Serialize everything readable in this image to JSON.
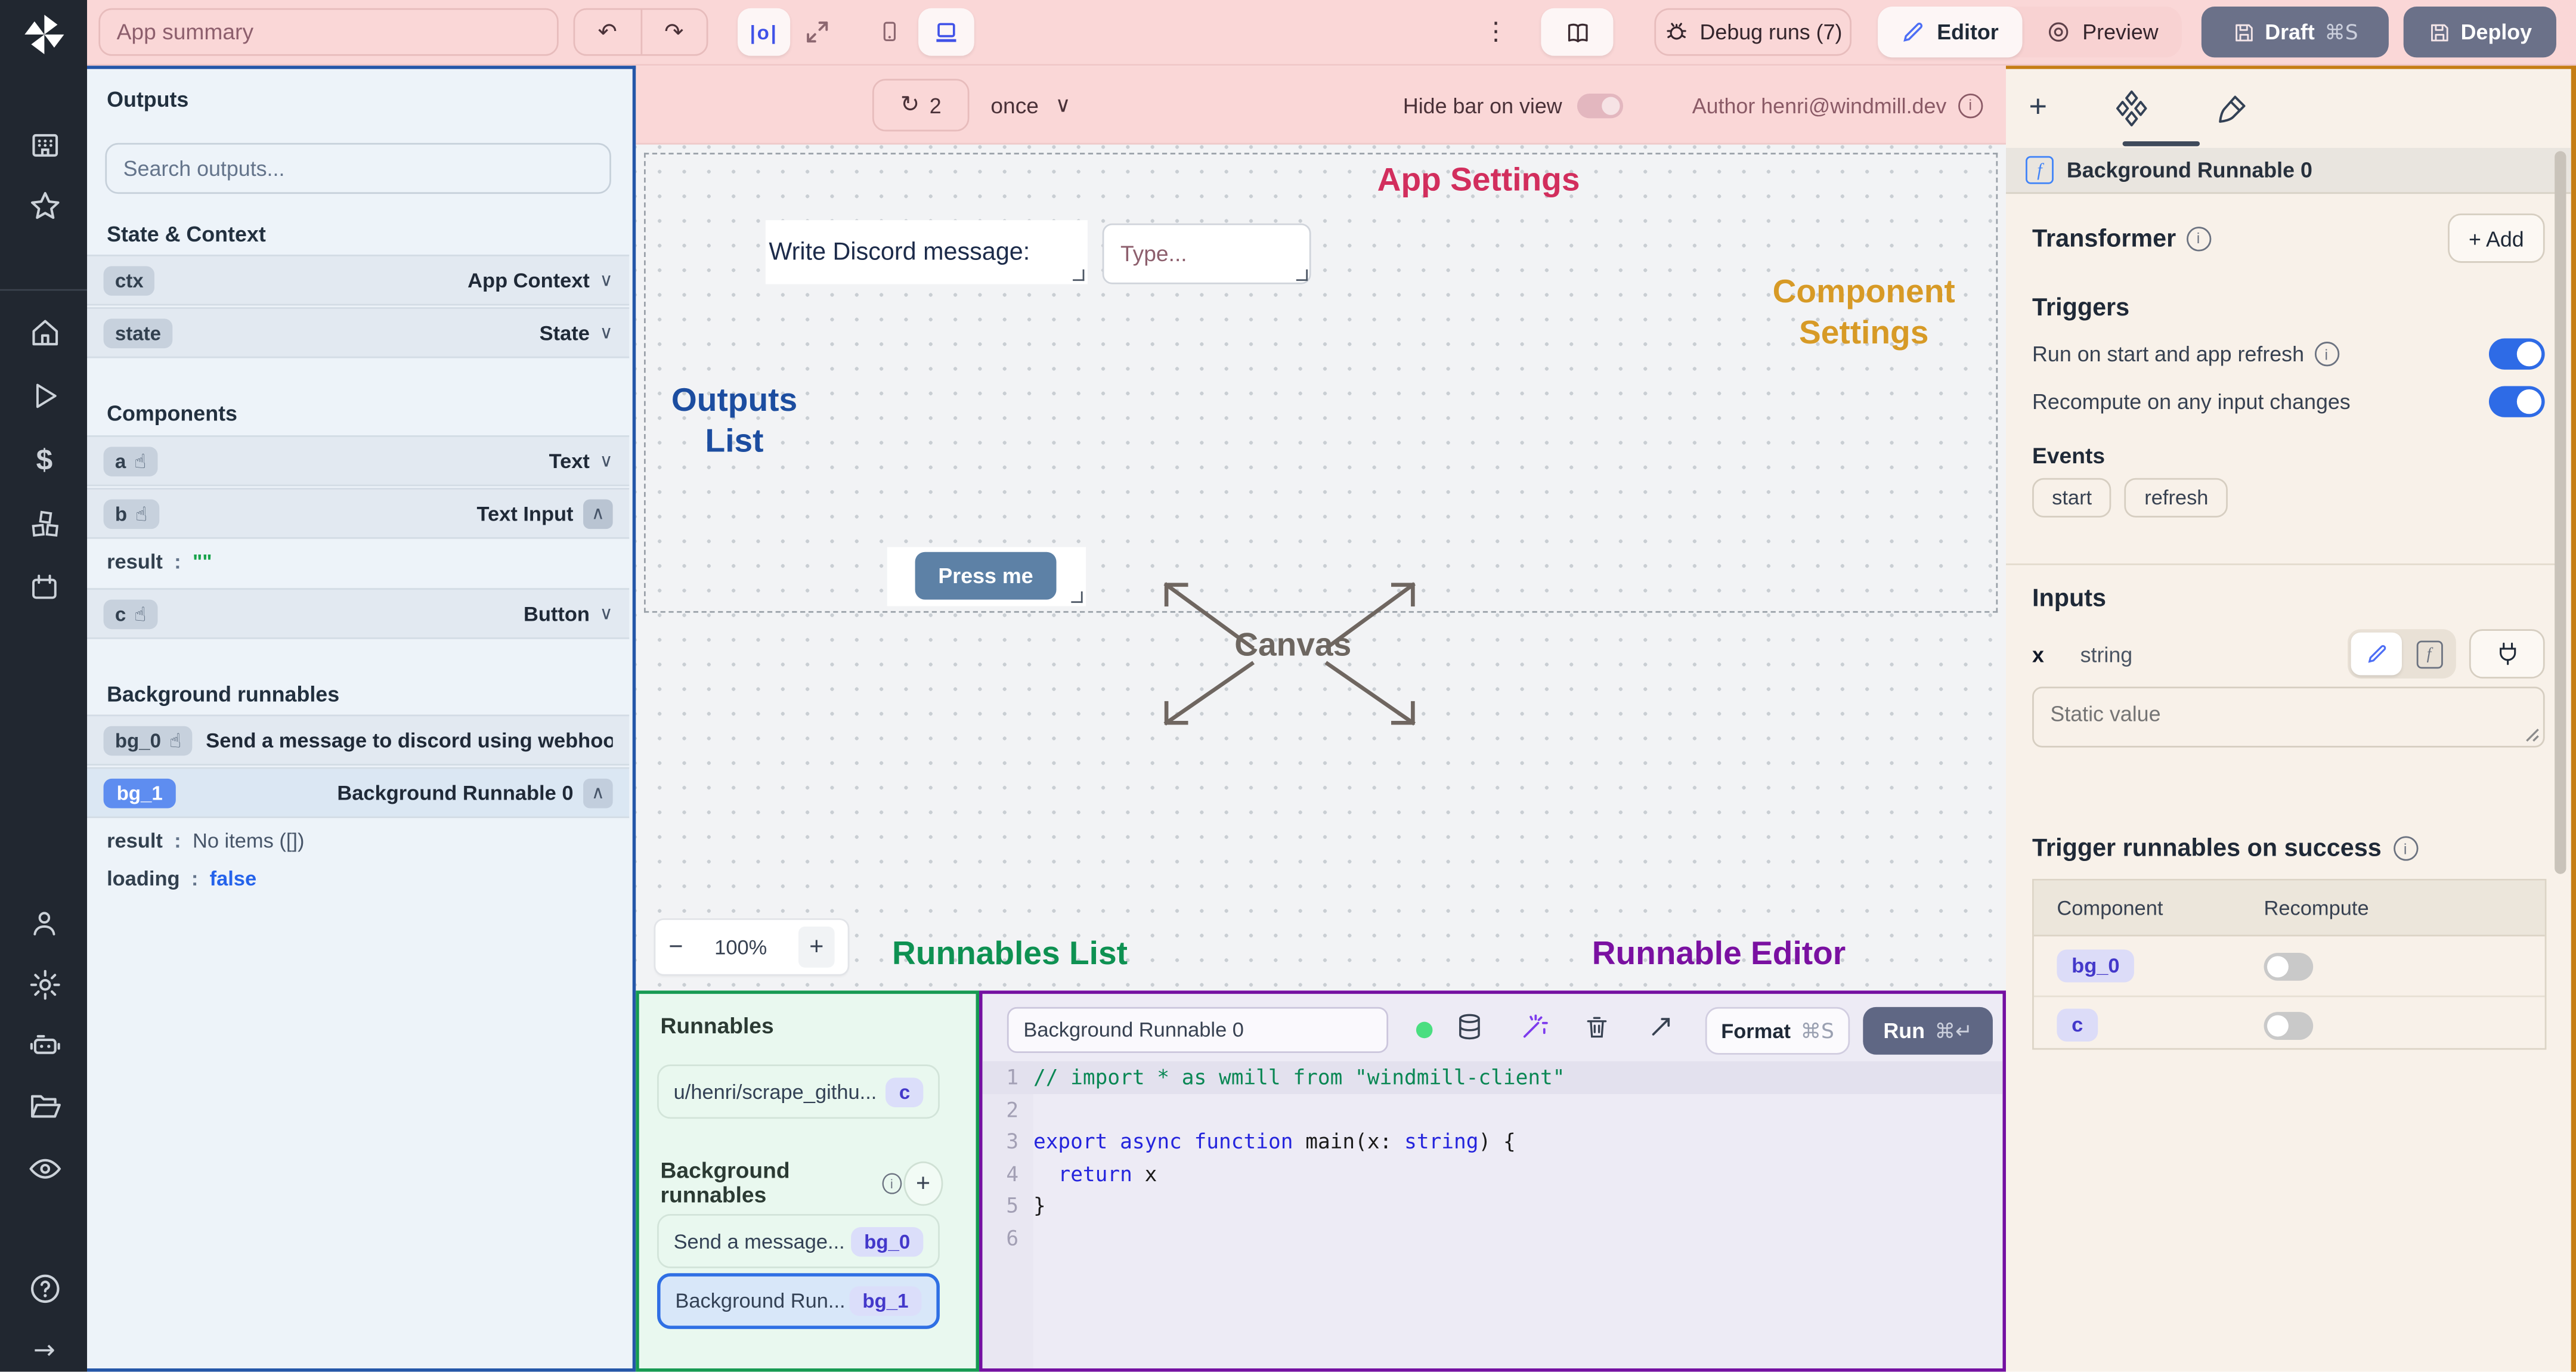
{
  "topbar": {
    "app_summary_placeholder": "App summary",
    "debug_runs_label": "Debug runs (7)",
    "editor_label": "Editor",
    "preview_label": "Preview",
    "draft_label": "Draft",
    "draft_shortcut": "⌘S",
    "deploy_label": "Deploy",
    "center_icon_label": "|o|"
  },
  "canvas_bar": {
    "refresh_count": "2",
    "frequency": "once",
    "hide_bar_label": "Hide bar on view",
    "author_label": "Author henri@windmill.dev"
  },
  "outputs_panel": {
    "title": "Outputs",
    "search_placeholder": "Search outputs...",
    "colon": ":",
    "state_context_title": "State & Context",
    "ctx_id": "ctx",
    "ctx_type": "App Context",
    "state_id": "state",
    "state_type": "State",
    "components_title": "Components",
    "comp_a_id": "a",
    "comp_a_type": "Text",
    "comp_b_id": "b",
    "comp_b_type": "Text Input",
    "comp_b_result_key": "result",
    "comp_b_result_value": "\"\"",
    "comp_c_id": "c",
    "comp_c_type": "Button",
    "background_title": "Background runnables",
    "bg0_id": "bg_0",
    "bg0_label": "Send a message to discord using webhoo",
    "bg1_id": "bg_1",
    "bg1_label": "Background Runnable 0",
    "bg1_result_key": "result",
    "bg1_result_value": "No items ([])",
    "bg1_loading_key": "loading",
    "bg1_loading_value": "false"
  },
  "canvas": {
    "app_settings": "App Settings",
    "component_settings_line1": "Component",
    "component_settings_line2": "Settings",
    "outputs_list_line1": "Outputs",
    "outputs_list_line2": "List",
    "canvas_label": "Canvas",
    "runnables_list_label": "Runnables List",
    "runnable_editor_label": "Runnable Editor",
    "text_component": "Write Discord message:",
    "input_placeholder": "Type...",
    "button_label": "Press me",
    "zoom_level": "100%",
    "zoom_out": "−",
    "zoom_in": "+"
  },
  "runnables_panel": {
    "title": "Runnables",
    "item1_label": "u/henri/scrape_githu...",
    "item1_badge": "c",
    "bg_title": "Background runnables",
    "add_label": "+",
    "bg0_label": "Send a message...",
    "bg0_badge": "bg_0",
    "bg1_label": "Background Run...",
    "bg1_badge": "bg_1"
  },
  "editor_panel": {
    "name_value": "Background Runnable 0",
    "format_label": "Format",
    "format_shortcut": "⌘S",
    "run_label": "Run",
    "run_shortcut": "⌘↵",
    "code_lines": [
      {
        "num": "1",
        "hl": true,
        "tokens": [
          {
            "t": "// import * as wmill from \"windmill-client\"",
            "c": "cmt"
          }
        ]
      },
      {
        "num": "2",
        "tokens": []
      },
      {
        "num": "3",
        "tokens": [
          {
            "t": "export",
            "c": "kw"
          },
          {
            "t": " ",
            "c": "pl"
          },
          {
            "t": "async",
            "c": "kw"
          },
          {
            "t": " ",
            "c": "pl"
          },
          {
            "t": "function",
            "c": "kw"
          },
          {
            "t": " main(x: ",
            "c": "pl"
          },
          {
            "t": "string",
            "c": "kw"
          },
          {
            "t": ") {",
            "c": "pl"
          }
        ]
      },
      {
        "num": "4",
        "tokens": [
          {
            "t": "  ",
            "c": "pl"
          },
          {
            "t": "return",
            "c": "kw"
          },
          {
            "t": " x",
            "c": "pl"
          }
        ]
      },
      {
        "num": "5",
        "tokens": [
          {
            "t": "}",
            "c": "pl"
          }
        ]
      },
      {
        "num": "6",
        "tokens": []
      }
    ]
  },
  "right_panel": {
    "header_label": "Background Runnable 0",
    "transformer_label": "Transformer",
    "add_label": "+ Add",
    "triggers_title": "Triggers",
    "run_on_start_label": "Run on start and app refresh",
    "recompute_label": "Recompute on any input changes",
    "events_title": "Events",
    "event_start": "start",
    "event_refresh": "refresh",
    "inputs_title": "Inputs",
    "input_name": "x",
    "input_type": "string",
    "static_value_placeholder": "Static value",
    "trigger_success_title": "Trigger runnables on success",
    "table_header_component": "Component",
    "table_header_recompute": "Recompute",
    "row1_badge": "bg_0",
    "row2_badge": "c"
  },
  "colors": {
    "annotation_red": "#d22e5d",
    "annotation_orange": "#d79a26",
    "annotation_blue": "#1c4da0",
    "annotation_green": "#0e9152",
    "annotation_purple": "#7a10a1",
    "accent_blue": "#2e6be6",
    "button_slate": "#6b7189",
    "press_me_blue": "#5d81a6"
  }
}
